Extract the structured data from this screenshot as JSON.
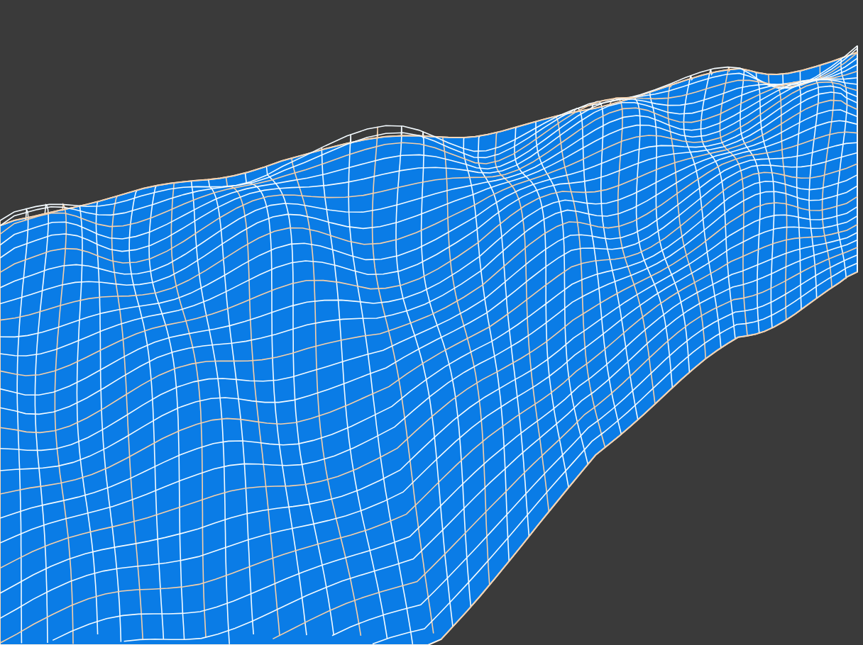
{
  "viewport": {
    "kind": "wireframe-terrain"
  }
}
